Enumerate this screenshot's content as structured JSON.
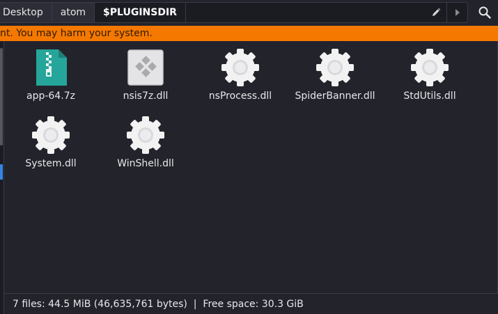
{
  "pathbar": {
    "crumbs": [
      "Desktop",
      "atom",
      "$PLUGINSDIR"
    ],
    "edit_icon": "pencil-icon",
    "next_icon": "chevron-right-icon",
    "search_icon": "search-icon"
  },
  "warning": {
    "text": "nt. You may harm your system."
  },
  "files": [
    {
      "name": "app-64.7z",
      "icon": "archive-icon"
    },
    {
      "name": "nsis7z.dll",
      "icon": "library-icon"
    },
    {
      "name": "nsProcess.dll",
      "icon": "gear-icon"
    },
    {
      "name": "SpiderBanner.dll",
      "icon": "gear-icon"
    },
    {
      "name": "StdUtils.dll",
      "icon": "gear-icon"
    },
    {
      "name": "System.dll",
      "icon": "gear-icon"
    },
    {
      "name": "WinShell.dll",
      "icon": "gear-icon"
    }
  ],
  "statusbar": {
    "text": "7 files: 44.5 MiB (46,635,761 bytes)  |  Free space: 30.3 GiB"
  },
  "colors": {
    "background": "#22232b",
    "warning": "#f57900",
    "archive": "#26a69a",
    "selection_marker": "#3584e4"
  }
}
